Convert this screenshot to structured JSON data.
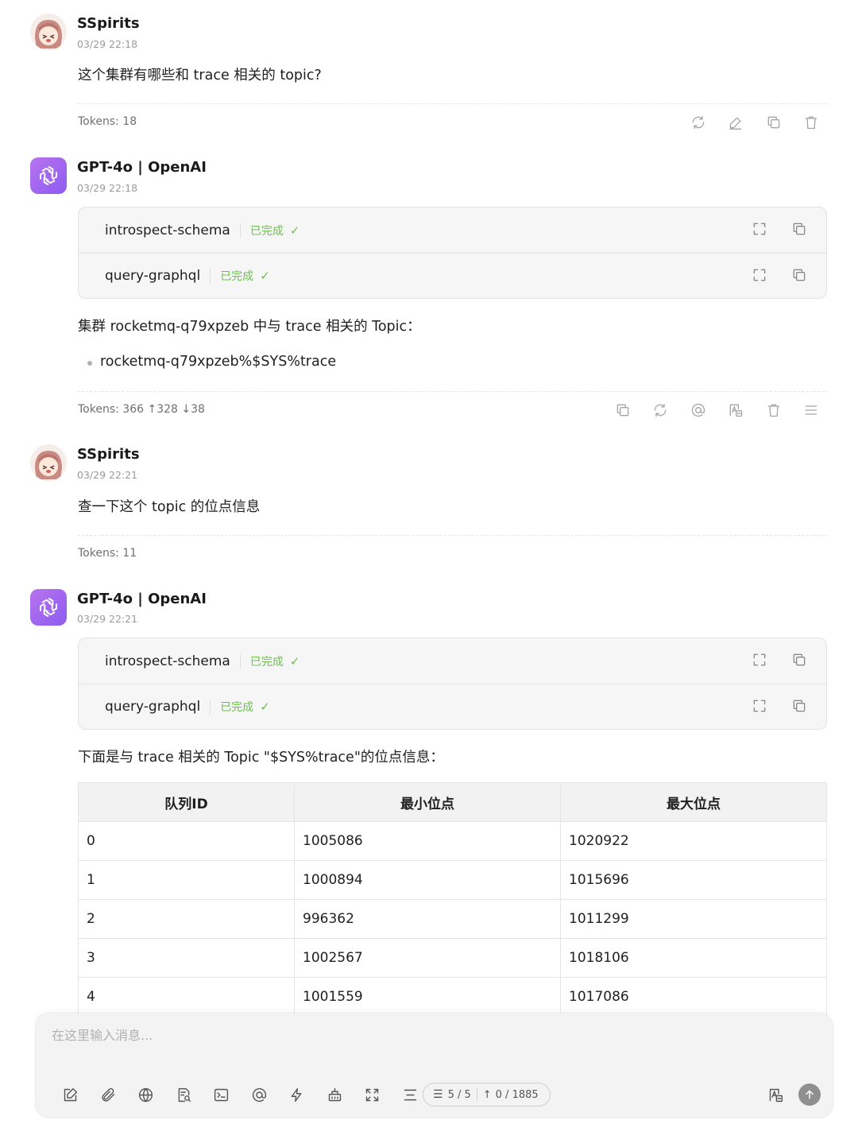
{
  "messages": [
    {
      "author": "SSpirits",
      "time": "03/29 22:18",
      "text": "这个集群有哪些和 trace 相关的 topic?",
      "tokens": "Tokens: 18"
    },
    {
      "author": "GPT-4o | OpenAI",
      "time": "03/29 22:18",
      "tools": [
        {
          "name": "introspect-schema",
          "status": "已完成"
        },
        {
          "name": "query-graphql",
          "status": "已完成"
        }
      ],
      "text": "集群 rocketmq-q79xpzeb 中与 trace 相关的 Topic：",
      "bullet": "rocketmq-q79xpzeb%$SYS%trace",
      "tokens": "Tokens: 366 ↑328 ↓38"
    },
    {
      "author": "SSpirits",
      "time": "03/29 22:21",
      "text": "查一下这个 topic 的位点信息",
      "tokens": "Tokens: 11"
    },
    {
      "author": "GPT-4o | OpenAI",
      "time": "03/29 22:21",
      "tools": [
        {
          "name": "introspect-schema",
          "status": "已完成"
        },
        {
          "name": "query-graphql",
          "status": "已完成"
        }
      ],
      "text": "下面是与 trace 相关的 Topic \"$SYS%trace\"的位点信息：",
      "table": {
        "headers": [
          "队列ID",
          "最小位点",
          "最大位点"
        ],
        "rows": [
          [
            "0",
            "1005086",
            "1020922"
          ],
          [
            "1",
            "1000894",
            "1015696"
          ],
          [
            "2",
            "996362",
            "1011299"
          ],
          [
            "3",
            "1002567",
            "1018106"
          ],
          [
            "4",
            "1001559",
            "1017086"
          ]
        ]
      }
    }
  ],
  "composer": {
    "placeholder": "在这里输入消息...",
    "context_count": "5 / 5",
    "token_count": "0 / 1885"
  },
  "colors": {
    "accent_purple": "#9b6cf0",
    "status_green": "#6cc14d"
  }
}
